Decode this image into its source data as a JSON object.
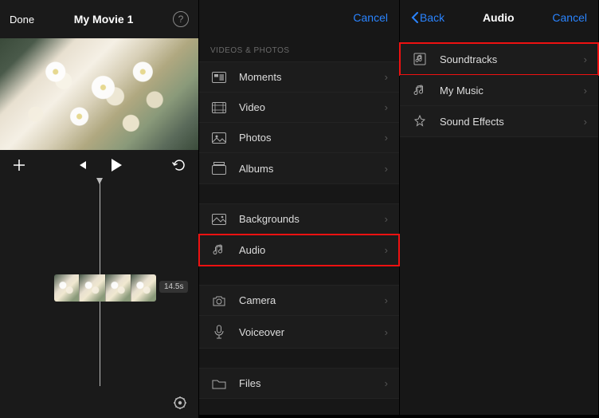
{
  "panel1": {
    "done": "Done",
    "title": "My Movie 1",
    "clip_duration": "14.5s"
  },
  "panel2": {
    "cancel": "Cancel",
    "section": "VIDEOS & PHOTOS",
    "items_group1": [
      {
        "icon": "moments",
        "label": "Moments"
      },
      {
        "icon": "video",
        "label": "Video"
      },
      {
        "icon": "photos",
        "label": "Photos"
      },
      {
        "icon": "albums",
        "label": "Albums"
      }
    ],
    "items_group2": [
      {
        "icon": "backgrounds",
        "label": "Backgrounds"
      },
      {
        "icon": "audio",
        "label": "Audio"
      }
    ],
    "items_group3": [
      {
        "icon": "camera",
        "label": "Camera"
      },
      {
        "icon": "voiceover",
        "label": "Voiceover"
      }
    ],
    "items_group4": [
      {
        "icon": "files",
        "label": "Files"
      }
    ]
  },
  "panel3": {
    "back": "Back",
    "title": "Audio",
    "cancel": "Cancel",
    "items": [
      {
        "icon": "soundtracks",
        "label": "Soundtracks"
      },
      {
        "icon": "mymusic",
        "label": "My Music"
      },
      {
        "icon": "soundeffects",
        "label": "Sound Effects"
      }
    ]
  }
}
